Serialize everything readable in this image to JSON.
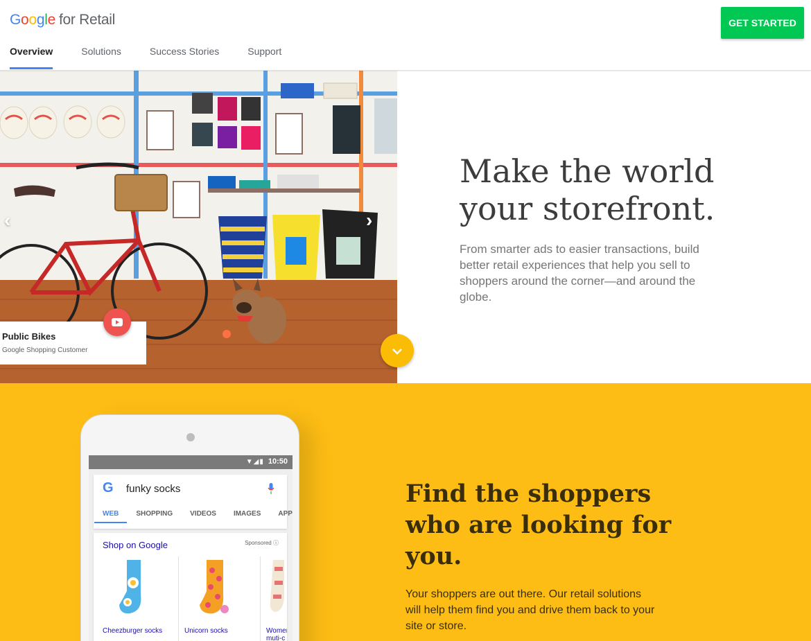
{
  "header": {
    "logo_word": [
      "G",
      "o",
      "o",
      "g",
      "l",
      "e"
    ],
    "logo_suffix": "for Retail",
    "nav": [
      {
        "label": "Overview",
        "active": true
      },
      {
        "label": "Solutions",
        "active": false
      },
      {
        "label": "Success Stories",
        "active": false
      },
      {
        "label": "Support",
        "active": false
      }
    ],
    "cta_label": "GET STARTED"
  },
  "hero": {
    "title": "Make the world your storefront.",
    "description": "From smarter ads to easier transactions, build better retail experiences that help you sell to shoppers around the corner—and around the globe.",
    "photo_card": {
      "title": "Public Bikes",
      "subtitle": "Google Shopping Customer"
    }
  },
  "find": {
    "title": "Find the shoppers who are looking for you.",
    "description": "Your shoppers are out there. Our retail solutions will help them find you and drive them back to your site or store.",
    "phone": {
      "time": "10:50",
      "query": "funky socks",
      "tabs": [
        "WEB",
        "SHOPPING",
        "VIDEOS",
        "IMAGES",
        "APPS"
      ],
      "shop_title": "Shop on Google",
      "sponsored": "Sponsored",
      "products": [
        "Cheezburger socks",
        "Unicorn socks",
        "Women muti-c"
      ]
    }
  },
  "colors": {
    "accent_blue": "#4285F4",
    "cta_green": "#00C853",
    "section_yellow": "#FDBD14",
    "youtube_red": "#EF5350"
  },
  "icons": [
    "youtube-play-icon",
    "chevron-left-icon",
    "chevron-right-icon",
    "chevron-down-icon",
    "google-g-icon",
    "mic-icon",
    "info-icon",
    "wifi-icon",
    "signal-icon",
    "battery-icon"
  ]
}
